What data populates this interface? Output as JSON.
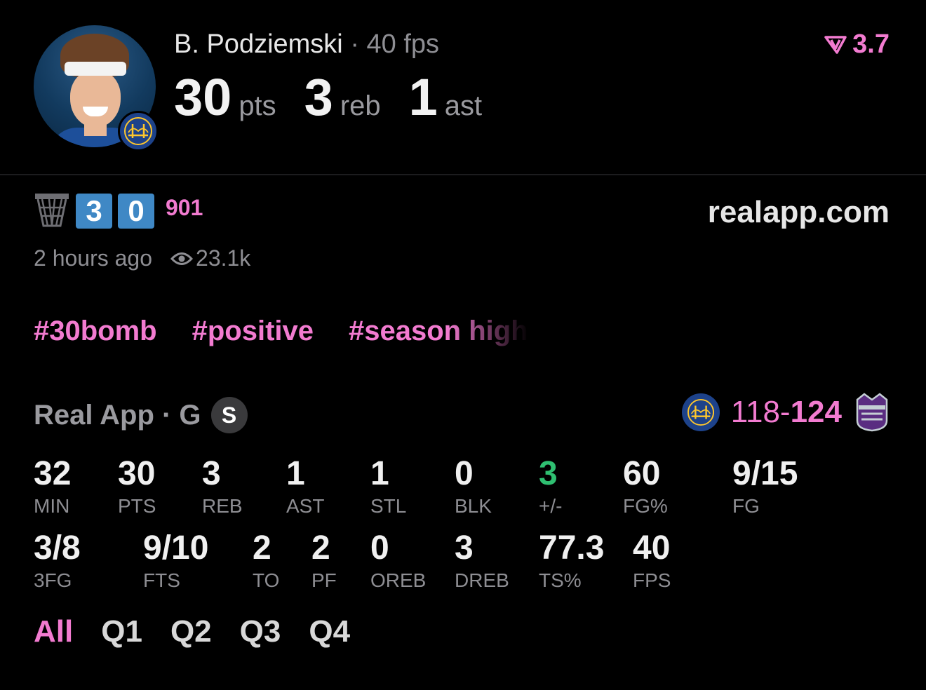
{
  "player": {
    "name": "B. Podziemski",
    "separator": "·",
    "fps": "40 fps",
    "rating": "3.7",
    "headline": [
      {
        "value": "30",
        "unit": "pts"
      },
      {
        "value": "3",
        "unit": "reb"
      },
      {
        "value": "1",
        "unit": "ast"
      }
    ]
  },
  "post": {
    "digits": [
      "3",
      "0"
    ],
    "points": "901",
    "site": "realapp.com",
    "time_ago": "2 hours ago",
    "views": "23.1k",
    "tags": [
      "#30bomb",
      "#positive",
      "#season high"
    ]
  },
  "game": {
    "league": "Real App · G",
    "badge": "S",
    "score_home": "118",
    "score_dash": "-",
    "score_away": "124"
  },
  "stats": {
    "row1": [
      {
        "value": "32",
        "label": "MIN"
      },
      {
        "value": "30",
        "label": "PTS"
      },
      {
        "value": "3",
        "label": "REB"
      },
      {
        "value": "1",
        "label": "AST"
      },
      {
        "value": "1",
        "label": "STL"
      },
      {
        "value": "0",
        "label": "BLK"
      },
      {
        "value": "3",
        "label": "+/-"
      },
      {
        "value": "60",
        "label": "FG%"
      },
      {
        "value": "9/15",
        "label": "FG"
      }
    ],
    "row2": [
      {
        "value": "3/8",
        "label": "3FG"
      },
      {
        "value": "9/10",
        "label": "FTS"
      },
      {
        "value": "2",
        "label": "TO"
      },
      {
        "value": "2",
        "label": "PF"
      },
      {
        "value": "0",
        "label": "OREB"
      },
      {
        "value": "3",
        "label": "DREB"
      },
      {
        "value": "77.3",
        "label": "TS%"
      },
      {
        "value": "40",
        "label": "FPS"
      }
    ]
  },
  "periods": [
    "All",
    "Q1",
    "Q2",
    "Q3",
    "Q4"
  ],
  "colors": {
    "accent": "#f27bd0",
    "positive": "#2fbf71",
    "digit_box": "#3f88c5",
    "background": "#000000"
  },
  "icons": {
    "rating": "rating-chevron-icon",
    "hoop": "basketball-hoop-icon",
    "views": "eye-icon",
    "warriors": "warriors-logo-icon",
    "kings": "kings-logo-icon"
  }
}
